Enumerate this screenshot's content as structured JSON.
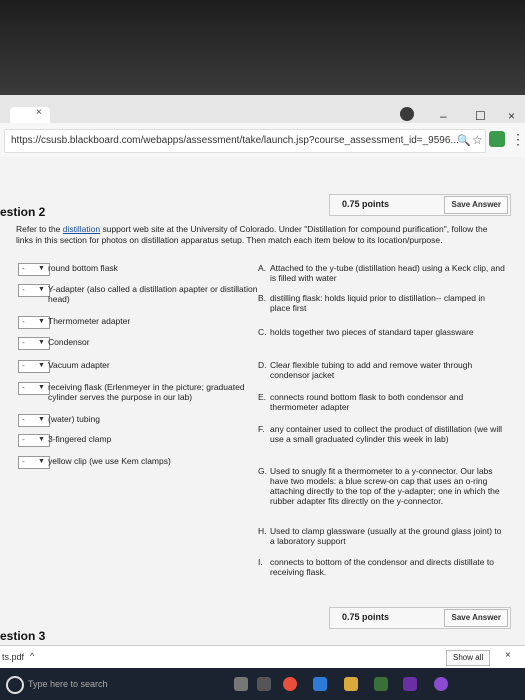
{
  "browser": {
    "tab_close": "×",
    "minimize": "–",
    "maximize": "☐",
    "close": "×",
    "url": "https://csusb.blackboard.com/webapps/assessment/take/launch.jsp?course_assessment_id=_9596...",
    "menu": "⋮"
  },
  "question2": {
    "points": "0.75 points",
    "save_label": "Save Answer",
    "title": "estion 2",
    "instructions_pre": "Refer to the ",
    "instructions_link": "distillation",
    "instructions_post": " support web site at the University of Colorado. Under \"Distillation for compound purification\", follow the links in this section for photos on distillation apparatus setup. Then match each item below to its location/purpose.",
    "items": [
      {
        "dash": "-",
        "label": "round bottom flask"
      },
      {
        "dash": "-",
        "label": "Y-adapter (also called a distillation apapter or distillation head)"
      },
      {
        "dash": "-",
        "label": "Thermometer adapter"
      },
      {
        "dash": "-",
        "label": "Condensor"
      },
      {
        "dash": "-",
        "label": "Vacuum adapter"
      },
      {
        "dash": "-",
        "label": "receiving flask (Erlenmeyer in the picture; graduated cylinder serves the purpose in our lab)"
      },
      {
        "dash": "-",
        "label": "(water) tubing"
      },
      {
        "dash": "-",
        "label": "3-fingered clamp"
      },
      {
        "dash": "-",
        "label": "yellow clip (we use Kem clamps)"
      }
    ],
    "options": [
      {
        "letter": "A.",
        "text": "Attached to the y-tube (distillation head) using a Keck clip, and is filled with water"
      },
      {
        "letter": "B.",
        "text": "distilling flask: holds liquid prior to distillation-- clamped in place first"
      },
      {
        "letter": "C.",
        "text": "holds together two pieces of standard taper glassware"
      },
      {
        "letter": "D.",
        "text": "Clear flexible tubing to add and remove water through condensor jacket"
      },
      {
        "letter": "E.",
        "text": "connects round bottom flask to both condensor and thermometer adapter"
      },
      {
        "letter": "F.",
        "text": "any container used to collect the product of distillation (we will use a small graduated cylinder this week in lab)"
      },
      {
        "letter": "G.",
        "text": "Used to snugly fit a thermometer to a y-connector. Our labs have two models: a blue screw-on cap that uses an o-ring attaching directly to the top of the y-adapter; one in which the rubber adapter fits directly on the y-connector."
      },
      {
        "letter": "H.",
        "text": "Used to clamp glassware (usually at the ground glass joint) to a laboratory support"
      },
      {
        "letter": "I.",
        "text": "connects to bottom of the condensor and directs distillate to receiving flask."
      }
    ]
  },
  "question3": {
    "points": "0.75 points",
    "save_label": "Save Answer",
    "title": "estion 3"
  },
  "downloads": {
    "file": "ts.pdf",
    "arrow": "^",
    "show_all": "Show all",
    "close": "×"
  },
  "taskbar": {
    "search_placeholder": "Type here to search"
  }
}
